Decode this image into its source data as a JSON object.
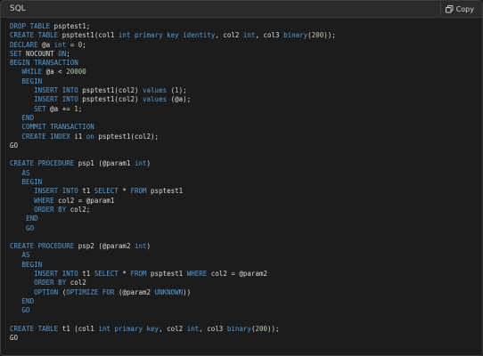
{
  "header": {
    "language_label": "SQL",
    "copy_label": "Copy",
    "copy_icon": "copy-icon"
  },
  "colors": {
    "keyword": "#569cd6",
    "text": "#dcdcdc",
    "number": "#b5cea8",
    "background": "#1c1c1c",
    "header_background": "#2b2b2b"
  },
  "code": {
    "lines": [
      [
        [
          "kw",
          "DROP TABLE"
        ],
        [
          "plain",
          " psptest1;"
        ]
      ],
      [
        [
          "kw",
          "CREATE TABLE"
        ],
        [
          "plain",
          " psptest1(col1 "
        ],
        [
          "kw",
          "int primary key identity"
        ],
        [
          "plain",
          ", col2 "
        ],
        [
          "kw",
          "int"
        ],
        [
          "plain",
          ", col3 "
        ],
        [
          "kw",
          "binary"
        ],
        [
          "plain",
          "("
        ],
        [
          "num",
          "200"
        ],
        [
          "plain",
          "));"
        ]
      ],
      [
        [
          "kw",
          "DECLARE"
        ],
        [
          "plain",
          " @a "
        ],
        [
          "kw",
          "int"
        ],
        [
          "plain",
          " = "
        ],
        [
          "num",
          "0"
        ],
        [
          "plain",
          ";"
        ]
      ],
      [
        [
          "kw",
          "SET"
        ],
        [
          "plain",
          " NOCOUNT "
        ],
        [
          "kw",
          "ON"
        ],
        [
          "plain",
          ";"
        ]
      ],
      [
        [
          "kw",
          "BEGIN TRANSACTION"
        ]
      ],
      [
        [
          "plain",
          "   "
        ],
        [
          "kw",
          "WHILE"
        ],
        [
          "plain",
          " @a < "
        ],
        [
          "num",
          "20000"
        ]
      ],
      [
        [
          "plain",
          "   "
        ],
        [
          "kw",
          "BEGIN"
        ]
      ],
      [
        [
          "plain",
          "      "
        ],
        [
          "kw",
          "INSERT INTO"
        ],
        [
          "plain",
          " psptest1(col2) "
        ],
        [
          "kw",
          "values"
        ],
        [
          "plain",
          " ("
        ],
        [
          "num",
          "1"
        ],
        [
          "plain",
          ");"
        ]
      ],
      [
        [
          "plain",
          "      "
        ],
        [
          "kw",
          "INSERT INTO"
        ],
        [
          "plain",
          " psptest1(col2) "
        ],
        [
          "kw",
          "values"
        ],
        [
          "plain",
          " (@a);"
        ]
      ],
      [
        [
          "plain",
          "      "
        ],
        [
          "kw",
          "SET"
        ],
        [
          "plain",
          " @a += "
        ],
        [
          "num",
          "1"
        ],
        [
          "plain",
          ";"
        ]
      ],
      [
        [
          "plain",
          "   "
        ],
        [
          "kw",
          "END"
        ]
      ],
      [
        [
          "plain",
          "   "
        ],
        [
          "kw",
          "COMMIT TRANSACTION"
        ]
      ],
      [
        [
          "plain",
          "   "
        ],
        [
          "kw",
          "CREATE INDEX"
        ],
        [
          "plain",
          " i1 "
        ],
        [
          "kw",
          "on"
        ],
        [
          "plain",
          " psptest1(col2);"
        ]
      ],
      [
        [
          "plain",
          "GO"
        ]
      ],
      [
        [
          "plain",
          ""
        ]
      ],
      [
        [
          "kw",
          "CREATE PROCEDURE"
        ],
        [
          "plain",
          " psp1 (@param1 "
        ],
        [
          "kw",
          "int"
        ],
        [
          "plain",
          ")"
        ]
      ],
      [
        [
          "plain",
          "   "
        ],
        [
          "kw",
          "AS"
        ]
      ],
      [
        [
          "plain",
          "   "
        ],
        [
          "kw",
          "BEGIN"
        ]
      ],
      [
        [
          "plain",
          "      "
        ],
        [
          "kw",
          "INSERT INTO"
        ],
        [
          "plain",
          " t1 "
        ],
        [
          "kw",
          "SELECT"
        ],
        [
          "plain",
          " * "
        ],
        [
          "kw",
          "FROM"
        ],
        [
          "plain",
          " psptest1"
        ]
      ],
      [
        [
          "plain",
          "      "
        ],
        [
          "kw",
          "WHERE"
        ],
        [
          "plain",
          " col2 = @param1"
        ]
      ],
      [
        [
          "plain",
          "      "
        ],
        [
          "kw",
          "ORDER BY"
        ],
        [
          "plain",
          " col2;"
        ]
      ],
      [
        [
          "plain",
          "    "
        ],
        [
          "kw",
          "END"
        ]
      ],
      [
        [
          "plain",
          "    "
        ],
        [
          "kw",
          "GO"
        ]
      ],
      [
        [
          "plain",
          ""
        ]
      ],
      [
        [
          "kw",
          "CREATE PROCEDURE"
        ],
        [
          "plain",
          " psp2 (@param2 "
        ],
        [
          "kw",
          "int"
        ],
        [
          "plain",
          ")"
        ]
      ],
      [
        [
          "plain",
          "   "
        ],
        [
          "kw",
          "AS"
        ]
      ],
      [
        [
          "plain",
          "   "
        ],
        [
          "kw",
          "BEGIN"
        ]
      ],
      [
        [
          "plain",
          "      "
        ],
        [
          "kw",
          "INSERT INTO"
        ],
        [
          "plain",
          " t1 "
        ],
        [
          "kw",
          "SELECT"
        ],
        [
          "plain",
          " * "
        ],
        [
          "kw",
          "FROM"
        ],
        [
          "plain",
          " psptest1 "
        ],
        [
          "kw",
          "WHERE"
        ],
        [
          "plain",
          " col2 = @param2"
        ]
      ],
      [
        [
          "plain",
          "      "
        ],
        [
          "kw",
          "ORDER BY"
        ],
        [
          "plain",
          " col2"
        ]
      ],
      [
        [
          "plain",
          "      "
        ],
        [
          "kw",
          "OPTION"
        ],
        [
          "plain",
          " ("
        ],
        [
          "kw",
          "OPTIMIZE FOR"
        ],
        [
          "plain",
          " (@param2 "
        ],
        [
          "kw",
          "UNKNOWN"
        ],
        [
          "plain",
          "))"
        ]
      ],
      [
        [
          "plain",
          "   "
        ],
        [
          "kw",
          "END"
        ]
      ],
      [
        [
          "plain",
          "   "
        ],
        [
          "kw",
          "GO"
        ]
      ],
      [
        [
          "plain",
          ""
        ]
      ],
      [
        [
          "kw",
          "CREATE TABLE"
        ],
        [
          "plain",
          " t1 (col1 "
        ],
        [
          "kw",
          "int primary key"
        ],
        [
          "plain",
          ", col2 "
        ],
        [
          "kw",
          "int"
        ],
        [
          "plain",
          ", col3 "
        ],
        [
          "kw",
          "binary"
        ],
        [
          "plain",
          "("
        ],
        [
          "num",
          "200"
        ],
        [
          "plain",
          "));"
        ]
      ],
      [
        [
          "plain",
          "GO"
        ]
      ]
    ]
  }
}
